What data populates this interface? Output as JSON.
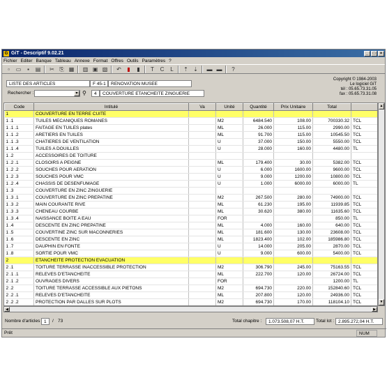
{
  "window": {
    "title": "GiT - Descriptif 9.02.21",
    "logo_text": "G"
  },
  "menu": [
    "Fichier",
    "Editer",
    "Banque",
    "Tableau",
    "Annexe",
    "Format",
    "Offres",
    "Outils",
    "Paramètres",
    "?"
  ],
  "toolbar_icons": [
    "new-icon",
    "open-icon",
    "save-icon",
    "print-preview-icon",
    "cut-icon",
    "copy-icon",
    "paste-icon",
    "print-icon",
    "preview-icon",
    "insert-icon",
    "undo-icon",
    "flag-red-icon",
    "flag-icon",
    "text-T-icon",
    "text-C-icon",
    "text-L-icon",
    "sort-asc-icon",
    "sort-desc-icon",
    "box-icon",
    "box2-icon",
    "help-icon"
  ],
  "toolbar_glyphs": [
    "▫",
    "▭",
    "▪",
    "▤",
    "✂",
    "⎘",
    "▦",
    "▥",
    "▣",
    "▧",
    "↶",
    "▮",
    "▮",
    "T",
    "C",
    "L",
    "⇡",
    "⇣",
    "▬",
    "▬",
    "?"
  ],
  "header": {
    "list_label": "LISTE DES ARTICLES",
    "doc_code": "F 45-1",
    "doc_title": "RENOVATION MUSEE",
    "search_label": "Rechercher :",
    "search_value": "",
    "current_num": "4",
    "current_text": "COUVERTURE ETANCHEITE ZINGUERIE",
    "copyright_lines": [
      "Copyright © 1984-2003",
      "Le logiciel GiT",
      "tél : 05.65.73.31.05",
      "fax : 05.65.73.31.08"
    ]
  },
  "columns": [
    "Code",
    "Intitulé",
    "Va",
    "Unité",
    "Quantité",
    "Prix Unitaire",
    "Total",
    ""
  ],
  "rows": [
    {
      "code": "1",
      "label": "COUVERTURE EN TERRE CUITE",
      "va": "",
      "unit": "",
      "qty": "",
      "price": "",
      "total": "",
      "t": "",
      "hl": true
    },
    {
      "code": "1 .1",
      "label": "TUILES MECANIQUES ROMANES",
      "va": "",
      "unit": "M2",
      "qty": "6484.540",
      "price": "108.00",
      "total": "700330.32",
      "t": "TCL"
    },
    {
      "code": "1 .1 .1",
      "label": "FAITAGE EN TUILES plates",
      "va": "",
      "unit": "ML",
      "qty": "26.000",
      "price": "115.00",
      "total": "2990.00",
      "t": "TCL"
    },
    {
      "code": "1 .1 .2",
      "label": "ARETIERS EN TUILES",
      "va": "",
      "unit": "ML",
      "qty": "91.700",
      "price": "115.00",
      "total": "10545.50",
      "t": "TCL"
    },
    {
      "code": "1 .1 .3",
      "label": "CHATIERES DE VENTILATION",
      "va": "",
      "unit": "U",
      "qty": "37.000",
      "price": "150.00",
      "total": "5550.00",
      "t": "TCL"
    },
    {
      "code": "1 .1 .4",
      "label": "TUILES A DOUILLES",
      "va": "",
      "unit": "U",
      "qty": "28.000",
      "price": "160.00",
      "total": "4480.00",
      "t": "TL"
    },
    {
      "code": "1 .2",
      "label": "ACCESSOIRES DE TOITURE",
      "va": "",
      "unit": "",
      "qty": "",
      "price": "",
      "total": "",
      "t": ""
    },
    {
      "code": "1 .2 .1",
      "label": "CLOSOIRS A PEIGNE",
      "va": "",
      "unit": "ML",
      "qty": "179.400",
      "price": "30.00",
      "total": "5382.00",
      "t": "TCL"
    },
    {
      "code": "1 .2 .2",
      "label": "SOUCHES POUR AERATION",
      "va": "",
      "unit": "U",
      "qty": "6.000",
      "price": "1600.00",
      "total": "9600.00",
      "t": "TCL"
    },
    {
      "code": "1 .2 .3",
      "label": "SOUCHES POUR VMC",
      "va": "",
      "unit": "U",
      "qty": "9.000",
      "price": "1200.00",
      "total": "10800.00",
      "t": "TCL"
    },
    {
      "code": "1 .2 .4",
      "label": "CHASSIS DE DESENFUMAGE",
      "va": "",
      "unit": "U",
      "qty": "1.000",
      "price": "6000.00",
      "total": "6000.00",
      "t": "TL"
    },
    {
      "code": "1 .3",
      "label": "COUVERTURE EN ZINC ZINGUERIE",
      "va": "",
      "unit": "",
      "qty": "",
      "price": "",
      "total": "",
      "t": ""
    },
    {
      "code": "1 .3 .1",
      "label": "COUVERTURE EN ZINC PREPATINE",
      "va": "",
      "unit": "M2",
      "qty": "267.500",
      "price": "280.00",
      "total": "74900.00",
      "t": "TCL"
    },
    {
      "code": "1 .3 .2",
      "label": "MAIN COURANTE RIVE",
      "va": "",
      "unit": "ML",
      "qty": "61.230",
      "price": "195.00",
      "total": "11939.85",
      "t": "TCL"
    },
    {
      "code": "1 .3 .3",
      "label": "CHENEAU COURBE",
      "va": "",
      "unit": "ML",
      "qty": "30.620",
      "price": "380.00",
      "total": "11635.60",
      "t": "TCL"
    },
    {
      "code": "1 .3 .4",
      "label": "NAISSANCE BOITE A EAU",
      "va": "",
      "unit": "FOR",
      "qty": "",
      "price": "",
      "total": "850.00",
      "t": "TL"
    },
    {
      "code": "1 .4",
      "label": "DESCENTE EN ZINC PREPATINE",
      "va": "",
      "unit": "ML",
      "qty": "4.000",
      "price": "160.00",
      "total": "640.00",
      "t": "TCL"
    },
    {
      "code": "1 .5",
      "label": "COUVERTINE ZINC SUR MACONNERIES",
      "va": "",
      "unit": "ML",
      "qty": "181.600",
      "price": "130.00",
      "total": "23608.00",
      "t": "TCL"
    },
    {
      "code": "1 .6",
      "label": "DESCENTE EN ZINC",
      "va": "",
      "unit": "ML",
      "qty": "1823.400",
      "price": "102.00",
      "total": "185986.80",
      "t": "TCL"
    },
    {
      "code": "1 .7",
      "label": "DAUPHIN EN FONTE",
      "va": "",
      "unit": "U",
      "qty": "14.000",
      "price": "205.00",
      "total": "2870.00",
      "t": "TCL"
    },
    {
      "code": "1 .8",
      "label": "SORTIE POUR VMC",
      "va": "",
      "unit": "U",
      "qty": "9.000",
      "price": "600.00",
      "total": "5400.00",
      "t": "TCL"
    },
    {
      "code": "2",
      "label": "ETANCHEITE PROTECTION EVACUATION",
      "va": "",
      "unit": "",
      "qty": "",
      "price": "",
      "total": "",
      "t": "",
      "hl": true
    },
    {
      "code": "2 .1",
      "label": "TOITURE TERRASSE INACCESSIBLE PROTECTION",
      "va": "",
      "unit": "M2",
      "qty": "306.790",
      "price": "245.00",
      "total": "75163.55",
      "t": "TCL"
    },
    {
      "code": "2 .1 .1",
      "label": "RELEVES D'ETANCHEITE",
      "va": "",
      "unit": "ML",
      "qty": "222.700",
      "price": "120.00",
      "total": "26724.00",
      "t": "TCL"
    },
    {
      "code": "2 .1 .2",
      "label": "OUVRAGES DIVERS",
      "va": "",
      "unit": "FOR",
      "qty": "",
      "price": "",
      "total": "1200.00",
      "t": "TL"
    },
    {
      "code": "2 .2",
      "label": "TOITURE TERRASSE ACCESSIBLE AUX PIETONS",
      "va": "",
      "unit": "M2",
      "qty": "694.730",
      "price": "220.00",
      "total": "152840.60",
      "t": "TCL"
    },
    {
      "code": "2 .2 .1",
      "label": "RELEVES D'ETANCHEITE",
      "va": "",
      "unit": "ML",
      "qty": "207.800",
      "price": "120.00",
      "total": "24936.00",
      "t": "TCL"
    },
    {
      "code": "2 .2 .2",
      "label": "PROTECTION PAR DALLES SUR PLOTS",
      "va": "",
      "unit": "M2",
      "qty": "694.730",
      "price": "170.00",
      "total": "118104.10",
      "t": "TCL"
    }
  ],
  "footer": {
    "count_label": "Nombre d'articles :",
    "count_current": "1",
    "count_sep": "/",
    "count_total": "73",
    "chapter_label": "Total chapitre :",
    "chapter_value": "1.073.508,07 H.T.",
    "lot_label": "Total lot :",
    "lot_value": "2.895.272,04 H.T."
  },
  "status": {
    "left": "Prêt",
    "num": "NUM"
  }
}
